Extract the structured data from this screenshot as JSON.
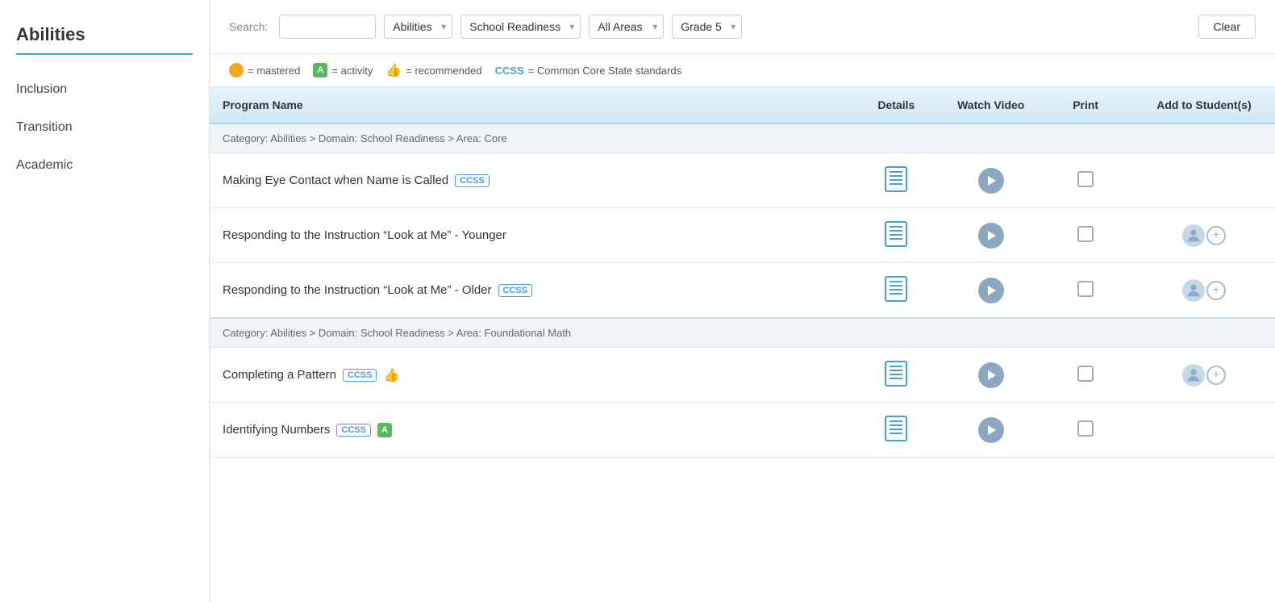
{
  "sidebar": {
    "title": "Abilities",
    "items": [
      {
        "label": "Inclusion",
        "id": "inclusion"
      },
      {
        "label": "Transition",
        "id": "transition"
      },
      {
        "label": "Academic",
        "id": "academic"
      }
    ]
  },
  "search": {
    "label": "Search:",
    "placeholder": "",
    "filters": {
      "category": "Abilities",
      "domain": "School Readiness",
      "area": "All Areas",
      "grade": "Grade 5"
    },
    "clear_label": "Clear"
  },
  "legend": {
    "mastered_label": "= mastered",
    "activity_label": "= activity",
    "recommended_label": "= recommended",
    "ccss_label": "CCSS",
    "ccss_desc": "= Common Core State standards"
  },
  "table": {
    "headers": {
      "program_name": "Program Name",
      "details": "Details",
      "watch_video": "Watch Video",
      "print": "Print",
      "add_to_students": "Add to Student(s)"
    },
    "categories": [
      {
        "id": "core",
        "label": "Category: Abilities >  Domain: School Readiness  >  Area: Core",
        "rows": [
          {
            "name": "Making Eye Contact when Name is Called",
            "ccss": true,
            "activity": false,
            "recommended": false,
            "has_add": false
          },
          {
            "name": "Responding to the Instruction “Look at Me” - Younger",
            "ccss": false,
            "activity": false,
            "recommended": false,
            "has_add": true
          },
          {
            "name": "Responding to the Instruction “Look at Me” - Older",
            "ccss": true,
            "activity": false,
            "recommended": false,
            "has_add": true
          }
        ]
      },
      {
        "id": "foundational-math",
        "label": "Category: Abilities >  Domain: School Readiness  >  Area: Foundational Math",
        "rows": [
          {
            "name": "Completing a Pattern",
            "ccss": true,
            "activity": false,
            "recommended": true,
            "has_add": true
          },
          {
            "name": "Identifying Numbers",
            "ccss": true,
            "activity": true,
            "recommended": false,
            "has_add": false
          }
        ]
      }
    ]
  }
}
